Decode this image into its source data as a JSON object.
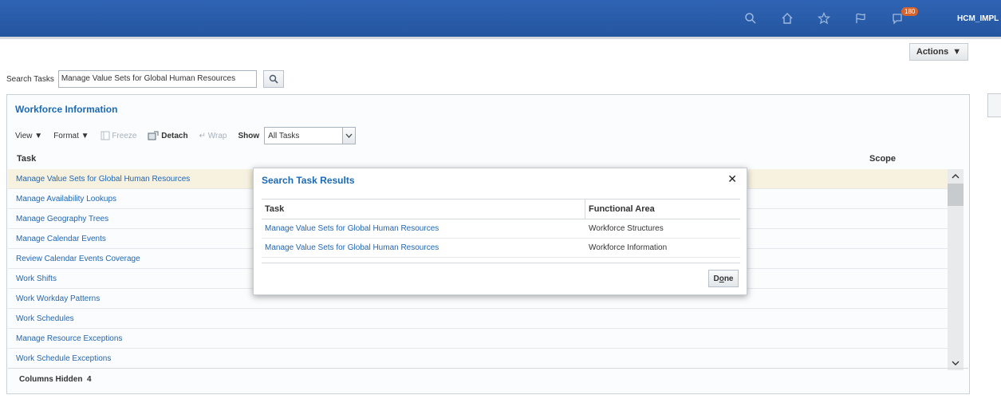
{
  "header": {
    "user": "HCM_IMPL",
    "notification_count": "180"
  },
  "actions_label": "Actions",
  "search": {
    "label": "Search Tasks",
    "value": "Manage Value Sets for Global Human Resources"
  },
  "panel": {
    "title": "Workforce Information",
    "toolbar": {
      "view": "View",
      "format": "Format",
      "freeze": "Freeze",
      "detach": "Detach",
      "wrap": "Wrap",
      "show": "Show",
      "show_value": "All Tasks"
    },
    "columns": {
      "task": "Task",
      "scope": "Scope"
    },
    "rows": [
      "Manage Value Sets for Global Human Resources",
      "Manage Availability Lookups",
      "Manage Geography Trees",
      "Manage Calendar Events",
      "Review Calendar Events Coverage",
      "Work Shifts",
      "Work Workday Patterns",
      "Work Schedules",
      "Manage Resource Exceptions",
      "Work Schedule Exceptions"
    ],
    "footer_label": "Columns Hidden",
    "footer_count": "4"
  },
  "dialog": {
    "title": "Search Task Results",
    "columns": {
      "task": "Task",
      "area": "Functional Area"
    },
    "rows": [
      {
        "task": "Manage Value Sets for Global Human Resources",
        "area": "Workforce Structures"
      },
      {
        "task": "Manage Value Sets for Global Human Resources",
        "area": "Workforce Information"
      }
    ],
    "done_pre": "D",
    "done_u": "o",
    "done_post": "ne"
  }
}
